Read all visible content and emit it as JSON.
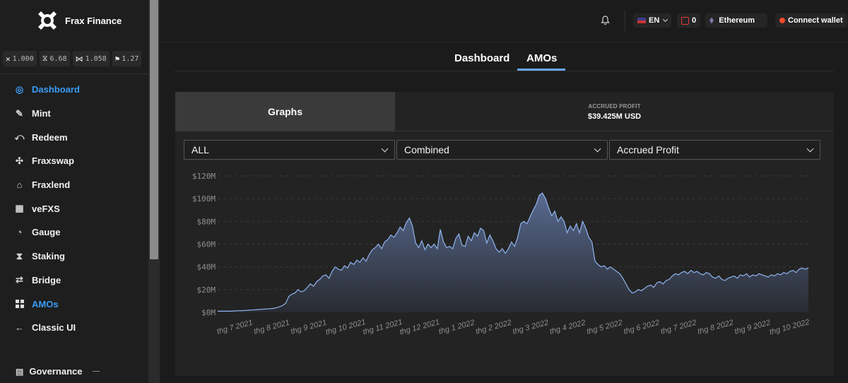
{
  "app": {
    "name": "Frax Finance"
  },
  "tokens": [
    {
      "icon": "frax-icon",
      "value": "1.000"
    },
    {
      "icon": "fxs-icon",
      "value": "6.68"
    },
    {
      "icon": "fpi-icon",
      "value": "1.058"
    },
    {
      "icon": "fpis-icon",
      "value": "1.27"
    }
  ],
  "sidebar": {
    "items": [
      {
        "label": "Dashboard",
        "icon": "dashboard-icon",
        "active": true
      },
      {
        "label": "Mint",
        "icon": "mint-icon"
      },
      {
        "label": "Redeem",
        "icon": "redeem-icon"
      },
      {
        "label": "Fraxswap",
        "icon": "fraxswap-icon"
      },
      {
        "label": "Fraxlend",
        "icon": "fraxlend-icon"
      },
      {
        "label": "veFXS",
        "icon": "vefxs-icon"
      },
      {
        "label": "Gauge",
        "icon": "gauge-icon"
      },
      {
        "label": "Staking",
        "icon": "staking-icon"
      },
      {
        "label": "Bridge",
        "icon": "bridge-icon"
      },
      {
        "label": "AMOs",
        "icon": "amos-icon",
        "active": true
      },
      {
        "label": "Classic UI",
        "icon": "back-arrow-icon"
      }
    ],
    "governance": "Governance"
  },
  "topbar": {
    "language": "EN",
    "notification_count": "0",
    "network": "Ethereum",
    "connect": "Connect wallet"
  },
  "tabs": [
    {
      "label": "Dashboard",
      "active": false
    },
    {
      "label": "AMOs",
      "active": true
    }
  ],
  "panel": {
    "graphs_tab": "Graphs",
    "profit_label": "ACCRUED PROFIT",
    "profit_value": "$39.425M USD",
    "filters": [
      "ALL",
      "Combined",
      "Accrued Profit"
    ]
  },
  "colors": {
    "accent": "#3a9bf5",
    "line": "#8fb4ef",
    "area_top": "#5b6f98",
    "area_bottom": "#2a2c33"
  },
  "chart_data": {
    "type": "area",
    "ylim": [
      0,
      120
    ],
    "yticks": [
      "$0M",
      "$20M",
      "$40M",
      "$60M",
      "$80M",
      "$100M",
      "$120M"
    ],
    "xticks": [
      "thg 7 2021",
      "thg 8 2021",
      "thg 9 2021",
      "thg 10 2021",
      "thg 11 2021",
      "thg 12 2021",
      "thg 1 2022",
      "thg 2 2022",
      "thg 3 2022",
      "thg 4 2022",
      "thg 5 2022",
      "thg 6 2022",
      "thg 7 2022",
      "thg 8 2022",
      "thg 9 2022",
      "thg 10 2022"
    ],
    "series": [
      {
        "values": [
          1,
          1,
          1,
          1,
          1,
          1.2,
          1.3,
          1.4,
          1.5,
          1.7,
          1.9,
          2,
          2.2,
          2.4,
          2.6,
          2.8,
          3,
          3.2,
          3.5,
          4,
          5,
          6,
          8,
          14,
          16,
          17,
          20,
          18,
          19,
          22,
          25,
          23,
          27,
          29,
          32,
          33,
          30,
          36,
          40,
          38,
          37,
          41,
          39,
          44,
          42,
          46,
          44,
          48,
          45,
          51,
          55,
          57,
          60,
          56,
          62,
          64,
          68,
          66,
          70,
          75,
          72,
          79,
          83,
          76,
          61,
          57,
          63,
          55,
          60,
          57,
          60,
          56,
          73,
          62,
          57,
          58,
          56,
          65,
          69,
          59,
          58,
          67,
          63,
          70,
          67,
          74,
          72,
          61,
          68,
          63,
          56,
          53,
          56,
          52,
          56,
          62,
          58,
          66,
          78,
          80,
          78,
          84,
          90,
          95,
          103,
          105,
          100,
          92,
          85,
          89,
          80,
          84,
          80,
          70,
          76,
          72,
          78,
          70,
          80,
          74,
          66,
          62,
          45,
          42,
          40,
          41,
          38,
          40,
          38,
          36,
          34,
          30,
          25,
          20,
          17,
          18,
          20,
          19,
          21,
          23,
          24,
          22,
          26,
          27,
          25,
          28,
          29,
          32,
          34,
          33,
          35,
          36,
          34,
          37,
          35,
          36,
          34,
          33,
          35,
          34,
          31,
          30,
          32,
          29,
          28,
          30,
          31,
          32,
          30,
          33,
          32,
          34,
          31,
          33,
          32,
          34,
          33,
          32,
          31,
          33,
          32,
          34,
          33,
          35,
          34,
          36,
          37,
          35,
          38,
          39,
          38,
          39
        ]
      }
    ]
  }
}
